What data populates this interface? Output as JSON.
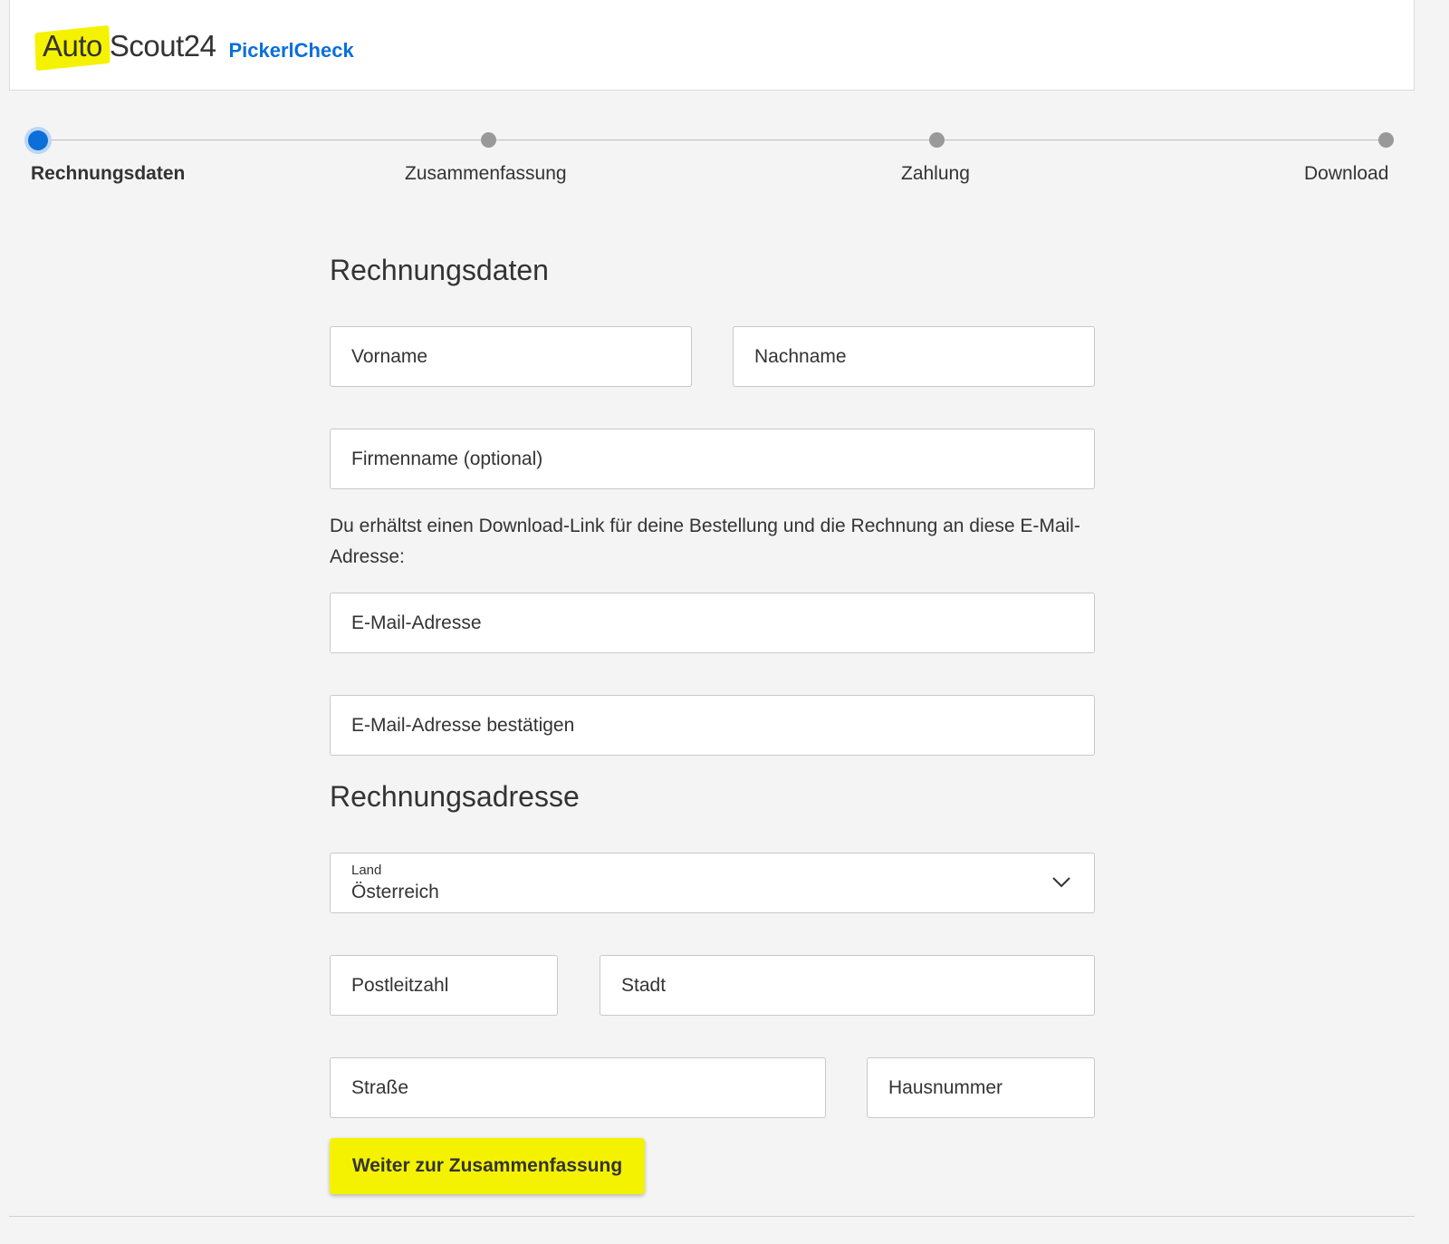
{
  "header": {
    "logo_auto": "Auto",
    "logo_scout": "Scout24",
    "logo_sub": "PickerlCheck"
  },
  "steps": [
    {
      "label": "Rechnungsdaten",
      "active": true
    },
    {
      "label": "Zusammenfassung",
      "active": false
    },
    {
      "label": "Zahlung",
      "active": false
    },
    {
      "label": "Download",
      "active": false
    }
  ],
  "billing": {
    "title": "Rechnungsdaten",
    "first_name_placeholder": "Vorname",
    "last_name_placeholder": "Nachname",
    "company_placeholder": "Firmenname (optional)",
    "email_note": "Du erhältst einen Download-Link für deine Bestellung und die Rechnung an diese E-Mail-Adresse:",
    "email_placeholder": "E-Mail-Adresse",
    "email_confirm_placeholder": "E-Mail-Adresse bestätigen"
  },
  "address": {
    "title": "Rechnungsadresse",
    "country_label": "Land",
    "country_value": "Österreich",
    "zip_placeholder": "Postleitzahl",
    "city_placeholder": "Stadt",
    "street_placeholder": "Straße",
    "house_number_placeholder": "Hausnummer"
  },
  "submit_label": "Weiter zur Zusammenfassung",
  "colors": {
    "brand_yellow": "#f5f200",
    "accent_blue": "#0a6fd9"
  }
}
